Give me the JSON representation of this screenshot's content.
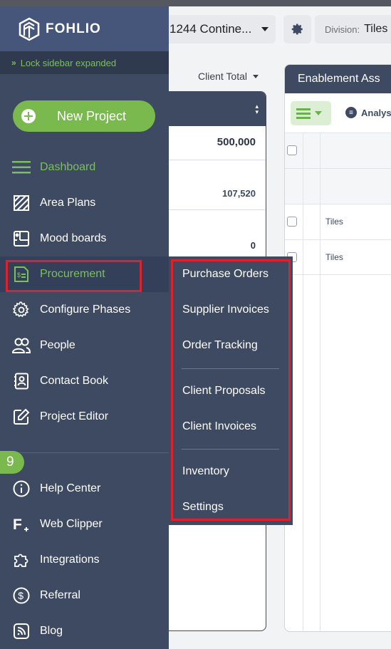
{
  "header": {
    "project_name": "1244 Contine...",
    "division_label": "Division:",
    "division_value": "Tiles"
  },
  "client_total_label": "Client Total",
  "left_table": {
    "values": [
      "500,000",
      "107,520",
      "0"
    ]
  },
  "right_panel": {
    "title": "Enablement Ass",
    "analysis_label": "Analys",
    "rows": [
      "Tiles",
      "Tiles"
    ]
  },
  "sidebar": {
    "logo": "FOHLIO",
    "lock_label": "Lock sidebar expanded",
    "new_project_label": "New Project",
    "badge_count": "9",
    "items": [
      {
        "label": "Dashboard",
        "icon": "hamburger-icon"
      },
      {
        "label": "Area Plans",
        "icon": "area-plan-icon"
      },
      {
        "label": "Mood boards",
        "icon": "moodboard-icon"
      },
      {
        "label": "Procurement",
        "icon": "procurement-icon"
      },
      {
        "label": "Configure Phases",
        "icon": "gear-icon"
      },
      {
        "label": "People",
        "icon": "people-icon"
      },
      {
        "label": "Contact Book",
        "icon": "contact-book-icon"
      },
      {
        "label": "Project Editor",
        "icon": "edit-icon"
      }
    ],
    "bottom_items": [
      {
        "label": "Help Center",
        "icon": "info-icon"
      },
      {
        "label": "Web Clipper",
        "icon": "web-clipper-icon"
      },
      {
        "label": "Integrations",
        "icon": "puzzle-icon"
      },
      {
        "label": "Referral",
        "icon": "dollar-icon"
      },
      {
        "label": "Blog",
        "icon": "rss-icon"
      }
    ]
  },
  "procurement_menu": {
    "group1": [
      "Purchase Orders",
      "Supplier Invoices",
      "Order Tracking"
    ],
    "group2": [
      "Client Proposals",
      "Client Invoices"
    ],
    "group3": [
      "Inventory",
      "Settings"
    ]
  },
  "colors": {
    "sidebar_bg": "#3e4a62",
    "accent_green": "#79b94e",
    "highlight_red": "#e0202a"
  }
}
